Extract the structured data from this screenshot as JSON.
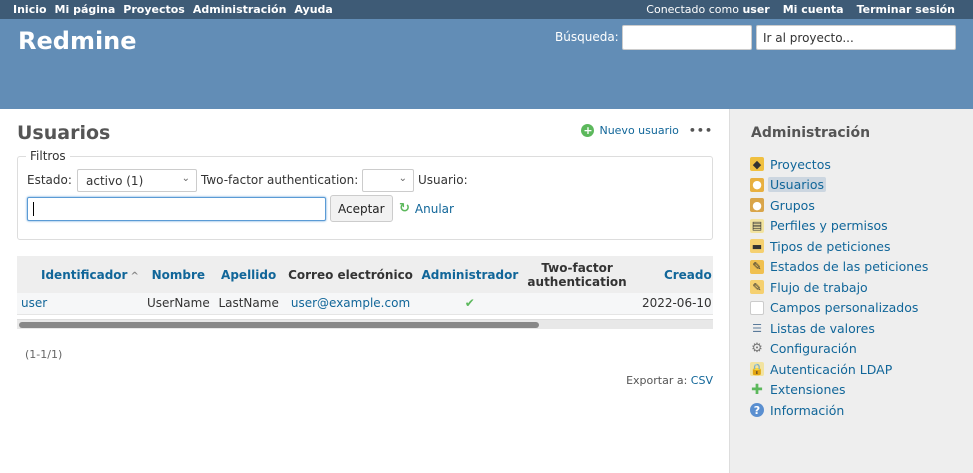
{
  "top_menu": {
    "left": [
      "Inicio",
      "Mi página",
      "Proyectos",
      "Administración",
      "Ayuda"
    ],
    "logged_as": "Conectado como",
    "user": "user",
    "my_account": "Mi cuenta",
    "logout": "Terminar sesión"
  },
  "header": {
    "title": "Redmine",
    "search_label": "Búsqueda:",
    "search_value": "",
    "project_jump": "Ir al proyecto..."
  },
  "content": {
    "title": "Usuarios",
    "new_user": "Nuevo usuario",
    "more": "•••",
    "filters": {
      "legend": "Filtros",
      "status_label": "Estado:",
      "status_value": "activo (1)",
      "twofa_label": "Two-factor authentication:",
      "twofa_value": "",
      "user_label": "Usuario:",
      "user_value": "",
      "apply": "Aceptar",
      "clear": "Anular"
    },
    "table": {
      "headers": [
        "Identificador",
        "Nombre",
        "Apellido",
        "Correo electrónico",
        "Administrador",
        "Two-factor",
        "authentication",
        "Creado"
      ],
      "rows": [
        {
          "login": "user",
          "firstname": "UserName",
          "lastname": "LastName",
          "email": "user@example.com",
          "admin": "✔",
          "twofa": "",
          "created": "2022-06-10"
        }
      ]
    },
    "pagination": "(1-1/1)",
    "export_label": "Exportar a:",
    "export_csv": "CSV"
  },
  "sidebar": {
    "title": "Administración",
    "items": [
      {
        "label": "Proyectos",
        "icon": "projects-icon"
      },
      {
        "label": "Usuarios",
        "icon": "users-icon",
        "selected": true
      },
      {
        "label": "Grupos",
        "icon": "groups-icon"
      },
      {
        "label": "Perfiles y permisos",
        "icon": "roles-icon"
      },
      {
        "label": "Tipos de peticiones",
        "icon": "trackers-icon"
      },
      {
        "label": "Estados de las peticiones",
        "icon": "issue-statuses-icon"
      },
      {
        "label": "Flujo de trabajo",
        "icon": "workflow-icon"
      },
      {
        "label": "Campos personalizados",
        "icon": "custom-fields-icon"
      },
      {
        "label": "Listas de valores",
        "icon": "enumerations-icon"
      },
      {
        "label": "Configuración",
        "icon": "settings-icon"
      },
      {
        "label": "Autenticación LDAP",
        "icon": "ldap-icon"
      },
      {
        "label": "Extensiones",
        "icon": "plugins-icon"
      },
      {
        "label": "Información",
        "icon": "info-icon"
      }
    ]
  }
}
